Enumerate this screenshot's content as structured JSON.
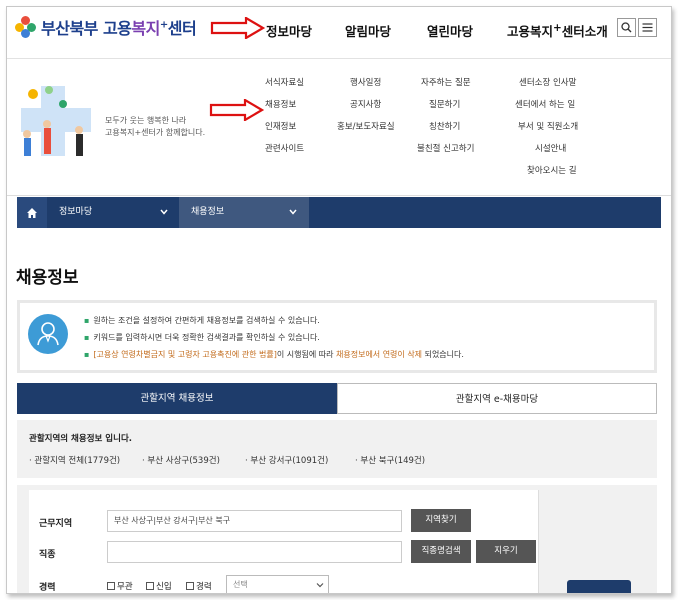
{
  "header": {
    "logo": {
      "part1": "부산북부 고용",
      "part2": "복지",
      "sup": "+",
      "part3": "센터"
    },
    "nav": [
      "정보마당",
      "알림마당",
      "열린마당",
      "고용복지",
      "센터소개"
    ],
    "nav_sup": "+",
    "search_icon": "search-icon",
    "menu_icon": "hamburger-menu-icon"
  },
  "mega": {
    "copy_line1": "모두가 웃는 행복한 나라",
    "copy_line2": "고용복지+센터가 함께합니다.",
    "col1": [
      "서식자료실",
      "채용정보",
      "인재정보",
      "관련사이트"
    ],
    "col2": [
      "행사일정",
      "공지사항",
      "홍보/보도자료실"
    ],
    "col3": [
      "자주하는 질문",
      "질문하기",
      "칭찬하기",
      "불친절 신고하기"
    ],
    "col4": [
      "센터소장 인사말",
      "센터에서 하는 일",
      "부서 및 직원소개",
      "시설안내",
      "찾아오시는 길"
    ]
  },
  "subnav": {
    "home_icon": "home-icon",
    "item1": "정보마당",
    "item2": "채용정보"
  },
  "page_title": "채용정보",
  "notice": {
    "line1": "원하는 조건을 설정하여 간편하게 채용정보를 검색하실 수 있습니다.",
    "line2": "키워드를 입력하시면 더욱 정확한 검색결과를 확인하실 수 있습니다.",
    "line3_a": "[고용상 연령차별금지 및 고령자 고용촉진에 관한 법률]",
    "line3_b": "이 시행됨에 따라 ",
    "line3_c": "채용정보에서 연령이 삭제",
    "line3_d": " 되었습니다."
  },
  "tabs": {
    "active": "관할지역 채용정보",
    "inactive": "관할지역 e-채용마당"
  },
  "summary": {
    "title": "관할지역의 채용정보 입니다.",
    "items": [
      "관할지역 전체(1779건)",
      "부산 사상구(539건)",
      "부산 강서구(1091건)",
      "부산 북구(149건)"
    ]
  },
  "form": {
    "region_label": "근무지역",
    "region_value": "부산 사상구|부산 강서구|부산 북구",
    "region_button": "지역찾기",
    "job_label": "직종",
    "job_value": "",
    "job_button": "직종명검색",
    "clear_button": "지우기",
    "career_label": "경력",
    "career_options": [
      "무관",
      "신입",
      "경력"
    ],
    "select_placeholder": "선택"
  },
  "colors": {
    "navy": "#1e3c6b",
    "logo_blue": "#1d3f8c",
    "accent_orange": "#c26a1a",
    "bullet_green": "#2fa56a"
  }
}
